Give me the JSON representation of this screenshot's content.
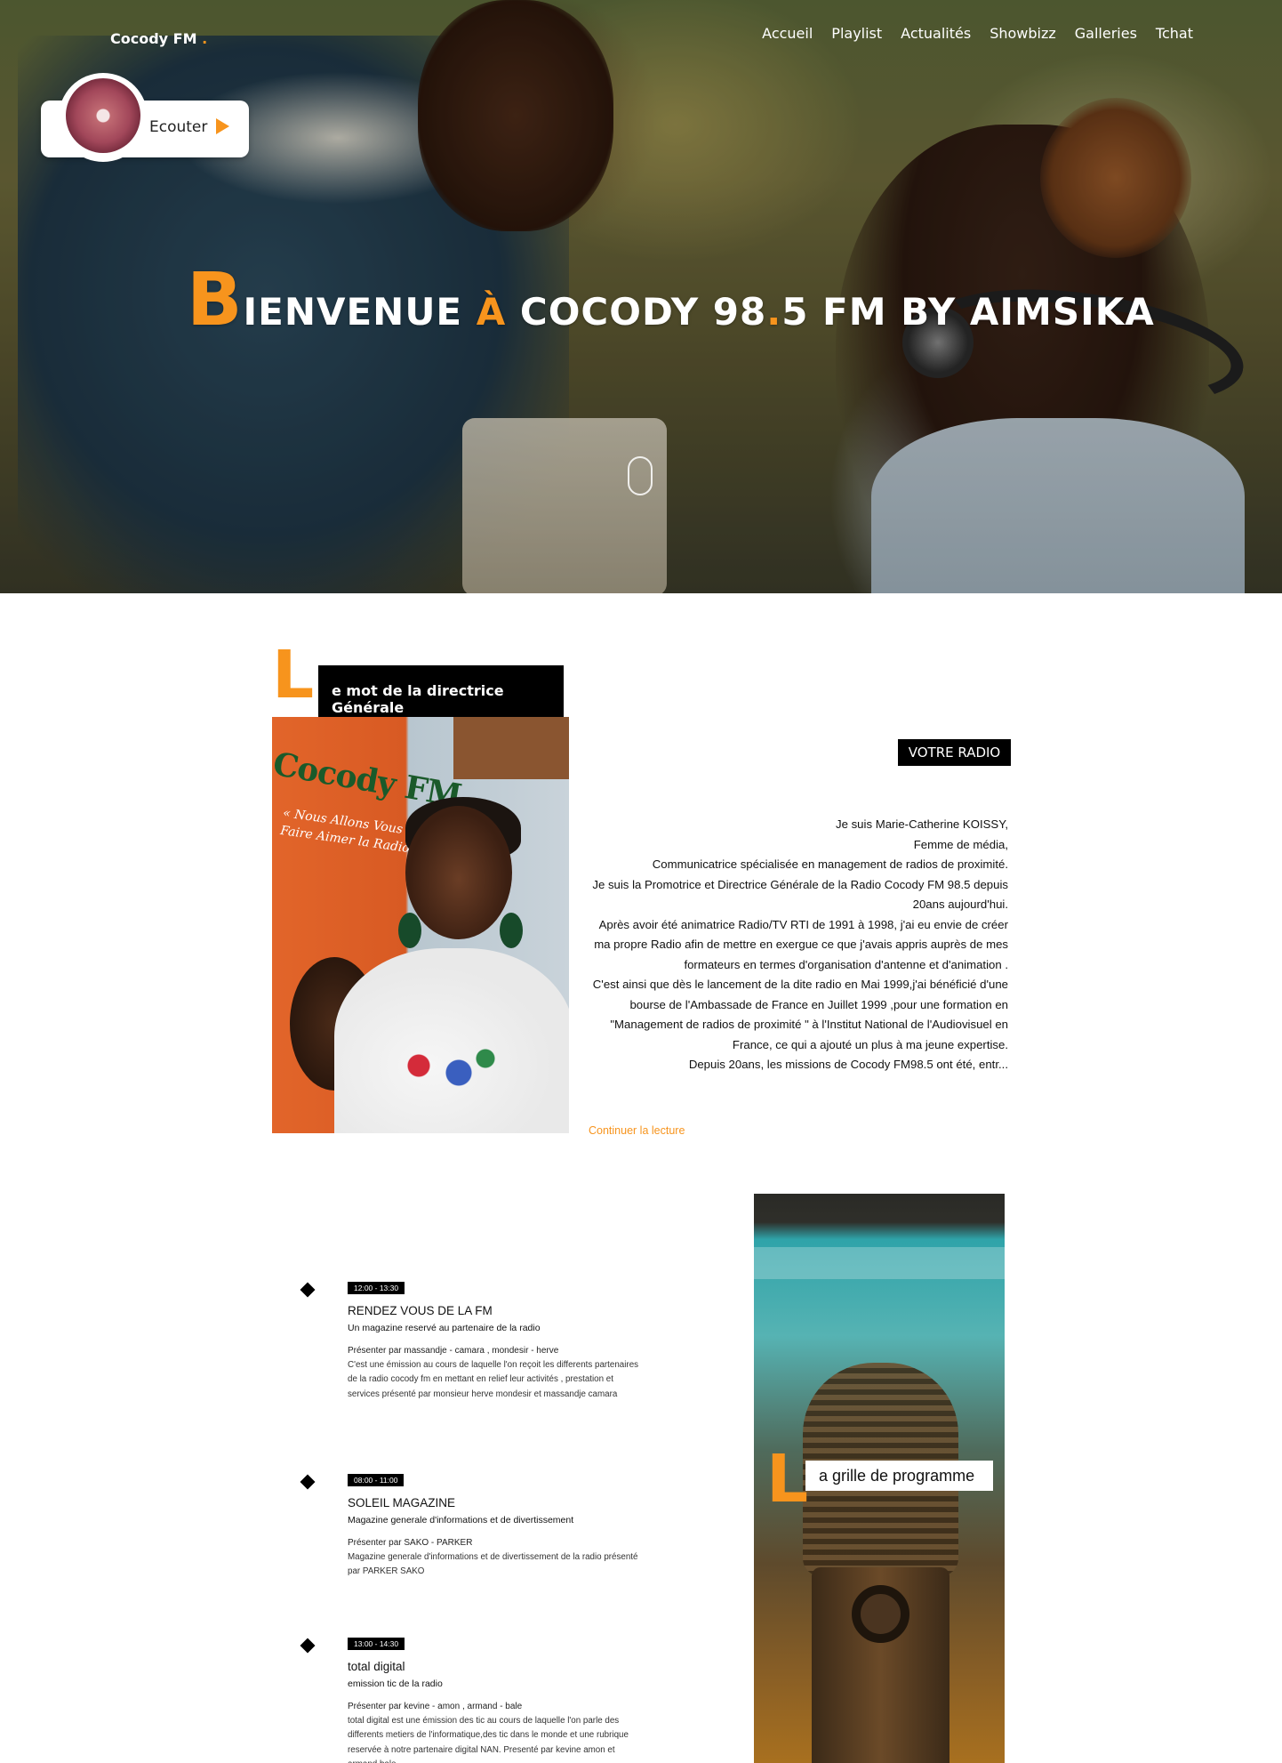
{
  "brand": {
    "name": "Cocody FM",
    "dot": "."
  },
  "nav": [
    "Accueil",
    "Playlist",
    "Actualités",
    "Showbizz",
    "Galleries",
    "Tchat"
  ],
  "player": {
    "label": "Ecouter"
  },
  "hero": {
    "title_first_letter": "B",
    "title_part1": "IENVENUE ",
    "title_accent": "À",
    "title_part2": " COCODY 98",
    "title_dot": ".",
    "title_part3": "5 FM BY AIMSIKA"
  },
  "director": {
    "letter": "L",
    "heading": "e mot de la directrice Générale",
    "badge": "VOTRE RADIO",
    "paragraphs": [
      "Je suis Marie-Catherine KOISSY,",
      "Femme de média,",
      "Communicatrice spécialisée en management de radios de proximité.",
      "Je suis la Promotrice et Directrice Générale de la Radio Cocody FM 98.5 depuis 20ans aujourd'hui.",
      "Après avoir été animatrice Radio/TV RTI de 1991 à 1998, j'ai eu envie de créer ma propre Radio afin de mettre en exergue ce que j'avais appris auprès de mes formateurs en termes d'organisation d'antenne et d'animation .",
      "C'est ainsi que dès le lancement de la dite radio en Mai 1999,j'ai bénéficié d'une bourse de l'Ambassade de France en Juillet 1999 ,pour une formation en \"Management de radios de proximité \" à l'Institut National de l'Audiovisuel en France, ce qui a ajouté un plus à ma jeune expertise.",
      "Depuis 20ans, les missions de Cocody FM98.5 ont été, entr..."
    ],
    "continue_label": "Continuer la lecture",
    "photo_banner_logo": "Cocody FM",
    "photo_banner_text": "« Nous Allons Vous Faire Aimer la Radio »"
  },
  "programme": {
    "letter": "L",
    "heading": "a grille de programme",
    "items": [
      {
        "time": "12:00 - 13:30",
        "title": "RENDEZ VOUS DE LA FM",
        "subtitle": "Un magazine reservé au partenaire de la radio",
        "presenter": "Présenter par massandje - camara , mondesir - herve",
        "description": "C'est une émission au cours de laquelle l'on reçoit les differents partenaires de la radio cocody fm en mettant en relief leur activités , prestation et services présenté par monsieur herve mondesir et massandje camara"
      },
      {
        "time": "08:00 - 11:00",
        "title": "SOLEIL MAGAZINE",
        "subtitle": "Magazine generale d'informations et de divertissement",
        "presenter": "Présenter par SAKO - PARKER",
        "description": "Magazine generale d'informations et de divertissement de la radio présenté par PARKER SAKO"
      },
      {
        "time": "13:00 - 14:30",
        "title": "total digital",
        "subtitle": "emission tic de la radio",
        "presenter": "Présenter par kevine - amon , armand - bale",
        "description": "total digital est une émission des tic au cours de laquelle l'on parle des differents metiers de l'informatique,des tic dans le monde et une rubrique reservée à notre partenaire digital NAN. Presenté par kevine amon et armand bale"
      }
    ]
  },
  "colors": {
    "accent": "#f7941d",
    "dark": "#000000",
    "text": "#111111"
  }
}
